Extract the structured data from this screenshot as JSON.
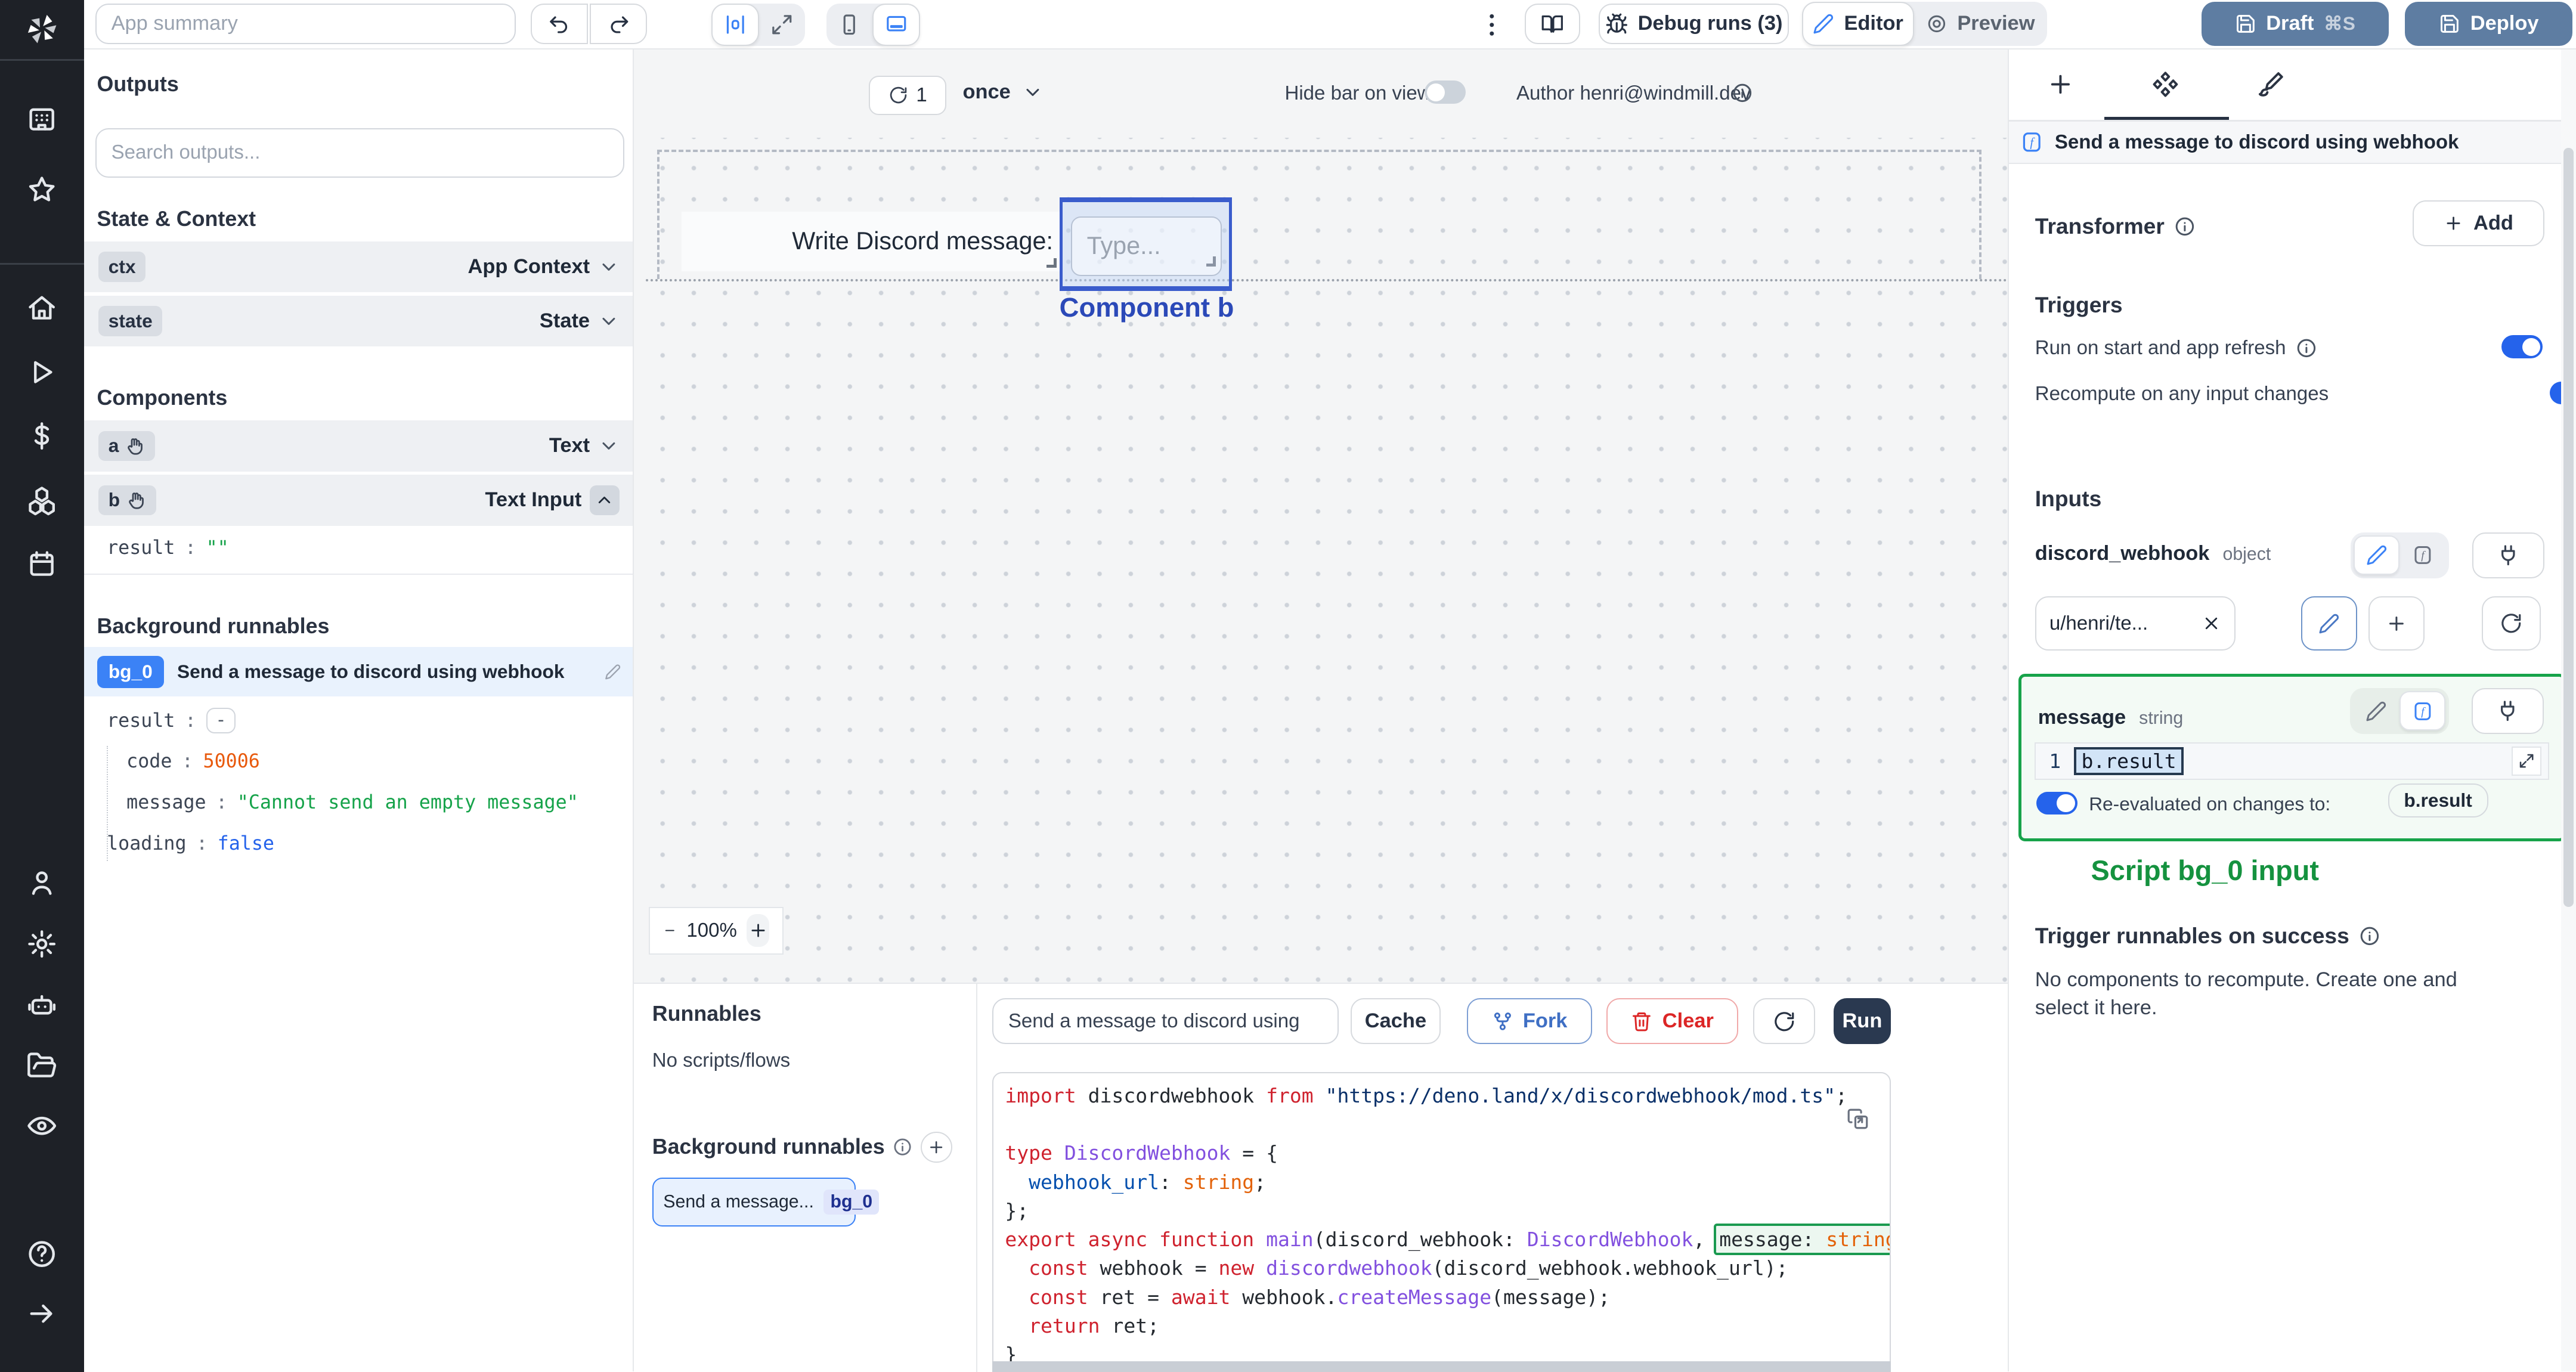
{
  "colors": {
    "accent_blue": "#3b82f6",
    "selection_blue": "#3a5ccc",
    "success_green": "#16a34a",
    "value_orange": "#e8590c",
    "value_blue": "#2563eb",
    "slate_button": "#5e7da2",
    "run_button": "#2a3950",
    "sidebar_bg": "#1e2127"
  },
  "topbar": {
    "app_summary_placeholder": "App summary",
    "debug_runs_label": "Debug runs (3)",
    "editor_label": "Editor",
    "preview_label": "Preview",
    "draft_label": "Draft",
    "draft_shortcut": "⌘S",
    "deploy_label": "Deploy"
  },
  "outputs_panel": {
    "title": "Outputs",
    "search_placeholder": "Search outputs...",
    "state_context_title": "State & Context",
    "state_rows": [
      {
        "key": "ctx",
        "type": "App Context"
      },
      {
        "key": "state",
        "type": "State"
      }
    ],
    "components_title": "Components",
    "component_rows": [
      {
        "key": "a",
        "type": "Text"
      },
      {
        "key": "b",
        "type": "Text Input"
      }
    ],
    "b_result": {
      "key": "result",
      "value": "\"\""
    },
    "background_title": "Background runnables",
    "bg0": {
      "badge": "bg_0",
      "label": "Send a message to discord using webhook",
      "result_key": "result",
      "fields": [
        {
          "key": "code",
          "value": "50006"
        },
        {
          "key": "message",
          "value": "\"Cannot send an empty message\""
        },
        {
          "key": "loading",
          "value": "false"
        }
      ]
    }
  },
  "canvas": {
    "refresh_count": "1",
    "schedule_mode": "once",
    "hide_bar_label": "Hide bar on view",
    "author_label": "Author henri@windmill.dev",
    "component_a_text": "Write Discord message:",
    "component_b_placeholder": "Type...",
    "component_b_label": "Component b",
    "zoom_level": "100%"
  },
  "runnables_panel": {
    "title": "Runnables",
    "empty_label": "No scripts/flows",
    "background_title": "Background runnables",
    "item_label": "Send a message...",
    "item_badge": "bg_0"
  },
  "code_panel": {
    "name_value": "Send a message to discord using",
    "cache_label": "Cache",
    "fork_label": "Fork",
    "clear_label": "Clear",
    "run_label": "Run",
    "lines": [
      [
        [
          "k",
          "import"
        ],
        [
          "n",
          " discordwebhook "
        ],
        [
          "k",
          "from"
        ],
        [
          "n",
          " "
        ],
        [
          "s",
          "\"https://deno.land/x/discordwebhook/mod.ts\""
        ],
        [
          "n",
          ";"
        ]
      ],
      [],
      [
        [
          "k",
          "type"
        ],
        [
          "n",
          " "
        ],
        [
          "t",
          "DiscordWebhook"
        ],
        [
          "n",
          " = {"
        ]
      ],
      [
        [
          "n",
          "  "
        ],
        [
          "p",
          "webhook_url"
        ],
        [
          "n",
          ": "
        ],
        [
          "o",
          "string"
        ],
        [
          "n",
          ";"
        ]
      ],
      [
        [
          "n",
          "};"
        ]
      ],
      [
        [
          "k",
          "export"
        ],
        [
          "n",
          " "
        ],
        [
          "k",
          "async"
        ],
        [
          "n",
          " "
        ],
        [
          "k",
          "function"
        ],
        [
          "n",
          " "
        ],
        [
          "f",
          "main"
        ],
        [
          "n",
          "(discord_webhook: "
        ],
        [
          "t",
          "DiscordWebhook"
        ],
        [
          "n",
          ", "
        ],
        [
          "nh",
          "message: "
        ],
        [
          "oh",
          "string"
        ],
        [
          "n",
          ") {"
        ]
      ],
      [
        [
          "n",
          "  "
        ],
        [
          "k",
          "const"
        ],
        [
          "n",
          " webhook = "
        ],
        [
          "k",
          "new"
        ],
        [
          "n",
          " "
        ],
        [
          "f",
          "discordwebhook"
        ],
        [
          "n",
          "(discord_webhook.webhook_url);"
        ]
      ],
      [
        [
          "n",
          "  "
        ],
        [
          "k",
          "const"
        ],
        [
          "n",
          " ret = "
        ],
        [
          "k",
          "await"
        ],
        [
          "n",
          " webhook."
        ],
        [
          "f",
          "createMessage"
        ],
        [
          "n",
          "(message);"
        ]
      ],
      [
        [
          "n",
          "  "
        ],
        [
          "k",
          "return"
        ],
        [
          "n",
          " ret;"
        ]
      ],
      [
        [
          "n",
          "}"
        ]
      ]
    ]
  },
  "right_panel": {
    "header_title": "Send a message to discord using webhook",
    "transformer_title": "Transformer",
    "add_label": "Add",
    "triggers_title": "Triggers",
    "trigger_rows": [
      "Run on start and app refresh",
      "Recompute on any input changes"
    ],
    "inputs_title": "Inputs",
    "discord_webhook": {
      "name": "discord_webhook",
      "type": "object",
      "value": "u/henri/te..."
    },
    "message": {
      "name": "message",
      "type": "string",
      "line_number": "1",
      "expression": "b.result",
      "reeval_label": "Re-evaluated on changes to:",
      "reeval_target": "b.result"
    },
    "script_input_caption": "Script bg_0 input",
    "on_success_title": "Trigger runnables on success",
    "on_success_line1": "No components to recompute. Create one and",
    "on_success_line2": "select it here."
  }
}
